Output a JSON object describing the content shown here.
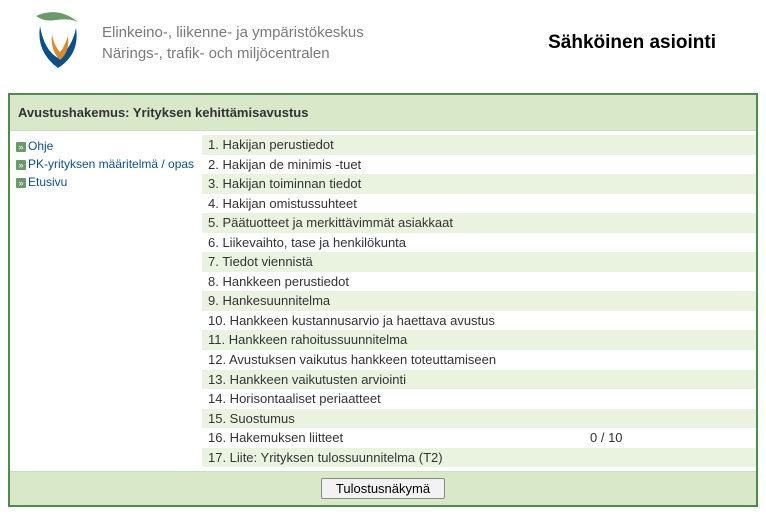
{
  "header": {
    "org_line1": "Elinkeino-, liikenne- ja ympäristökeskus",
    "org_line2": "Närings-, trafik- och miljöcentralen",
    "app_title": "Sähköinen asiointi"
  },
  "title_bar": "Avustushakemus: Yrityksen kehittämisavustus",
  "sidebar": {
    "items": [
      {
        "label": "Ohje"
      },
      {
        "label": "PK-yrityksen määritelmä / opas"
      },
      {
        "label": "Etusivu"
      }
    ]
  },
  "sections": [
    {
      "label": "1. Hakijan perustiedot"
    },
    {
      "label": "2. Hakijan de minimis -tuet"
    },
    {
      "label": "3. Hakijan toiminnan tiedot"
    },
    {
      "label": "4. Hakijan omistussuhteet"
    },
    {
      "label": "5. Päätuotteet ja merkittävimmät asiakkaat"
    },
    {
      "label": "6. Liikevaihto, tase ja henkilökunta"
    },
    {
      "label": "7. Tiedot viennistä"
    },
    {
      "label": "8. Hankkeen perustiedot"
    },
    {
      "label": "9. Hankesuunnitelma"
    },
    {
      "label": "10. Hankkeen kustannusarvio ja haettava avustus"
    },
    {
      "label": "11. Hankkeen rahoitussuunnitelma"
    },
    {
      "label": "12. Avustuksen vaikutus hankkeen toteuttamiseen"
    },
    {
      "label": "13. Hankkeen vaikutusten arviointi"
    },
    {
      "label": "14. Horisontaaliset periaatteet"
    },
    {
      "label": "15. Suostumus"
    },
    {
      "label": "16. Hakemuksen liitteet",
      "count": "0 / 10"
    },
    {
      "label": "17. Liite: Yrityksen tulossuunnitelma (T2)"
    }
  ],
  "footer": {
    "print_button": "Tulostusnäkymä"
  }
}
